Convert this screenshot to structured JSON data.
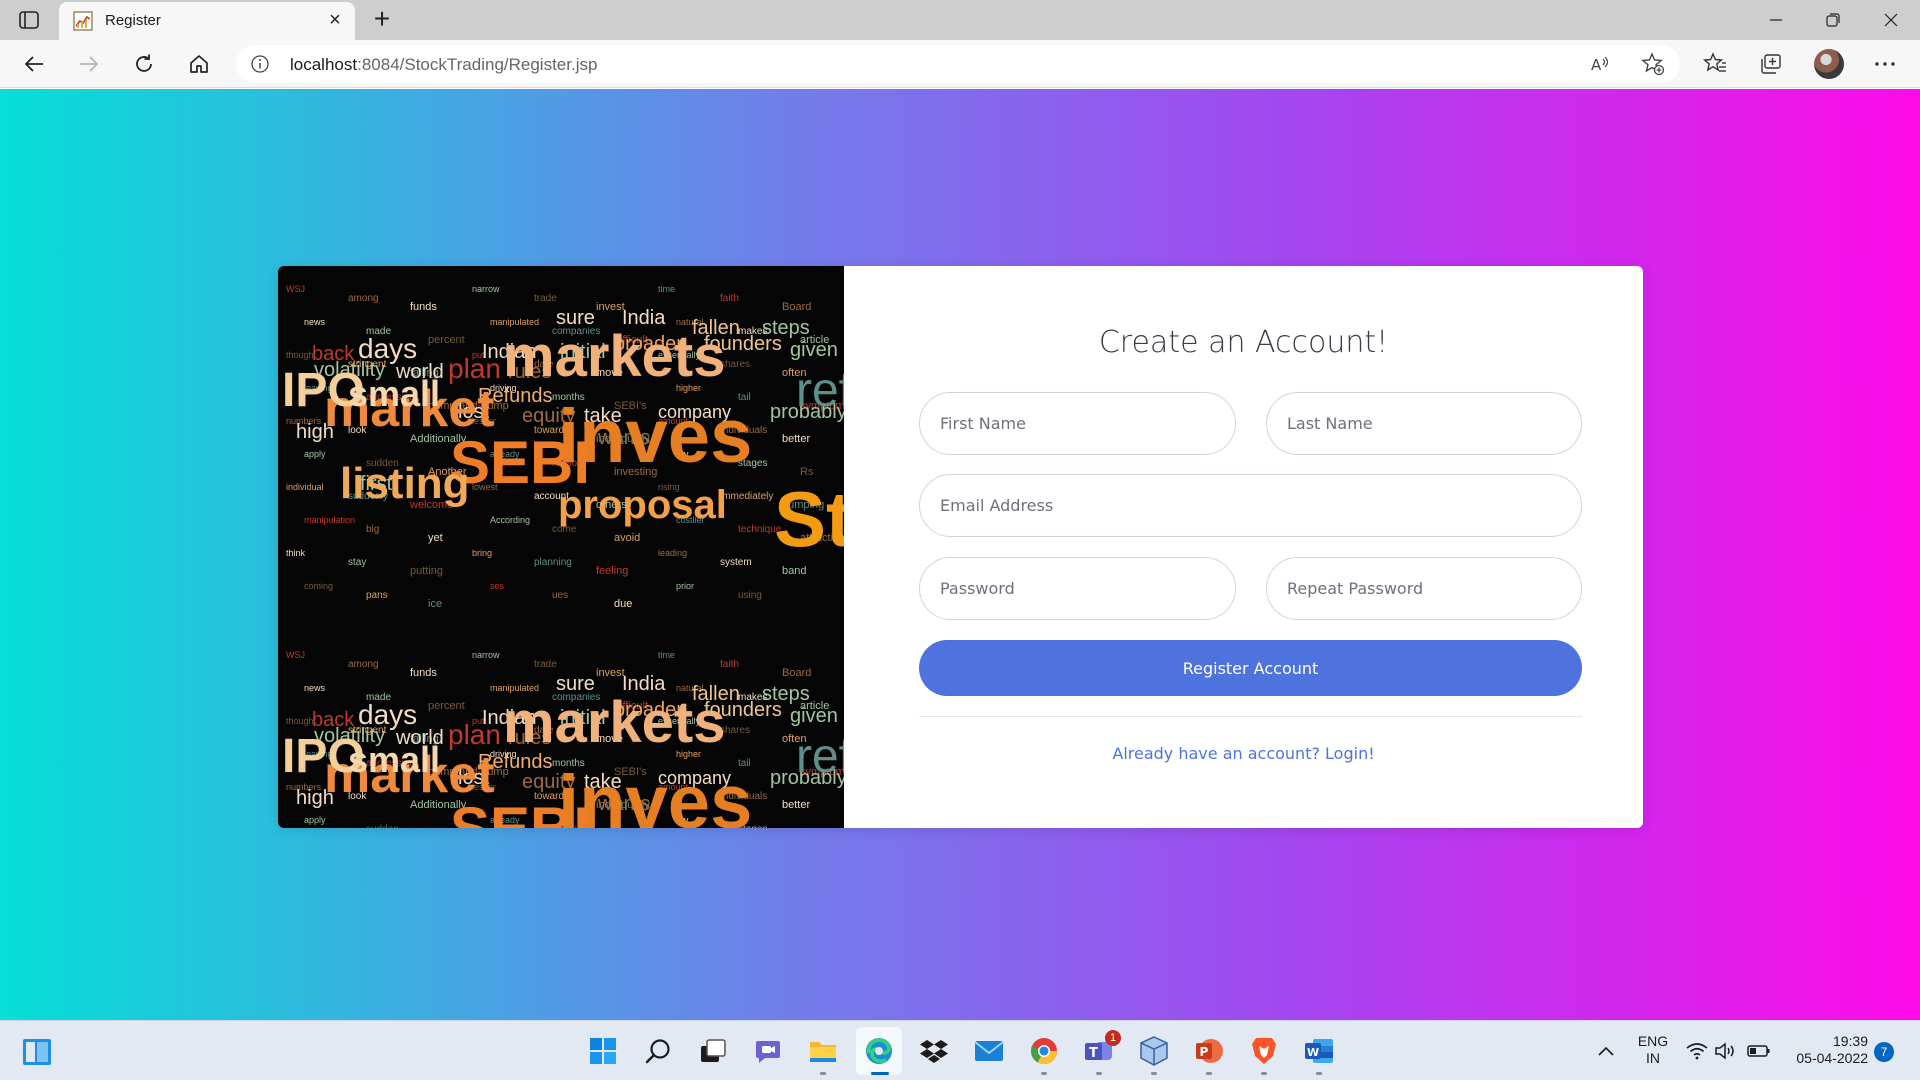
{
  "browser": {
    "tab_title": "Register",
    "new_tab_label": "+",
    "tab_close_label": "×",
    "url_host": "localhost",
    "url_rest": ":8084/StockTrading/Register.jsp"
  },
  "image_words": {
    "huge": [
      "markets",
      "inves",
      "market",
      "SEBI",
      "IPO",
      "listing",
      "proposal",
      "small",
      "St"
    ],
    "medium": [
      "days",
      "Indian",
      "founders",
      "fallen",
      "broader",
      "India",
      "sure",
      "world",
      "plan",
      "volatility",
      "Refunds",
      "equity",
      "take",
      "company",
      "probably",
      "wants",
      "high",
      "back",
      "lost",
      "first",
      "rules",
      "initial",
      "steps",
      "given",
      "refu"
    ],
    "small": [
      "WSJ",
      "among",
      "funds",
      "narrow",
      "trade",
      "invest",
      "time",
      "faith",
      "Board",
      "news",
      "made",
      "percent",
      "manipulated",
      "companies",
      "difficult",
      "natural",
      "makes",
      "article",
      "thought",
      "stringent",
      "falling",
      "put",
      "date",
      "move",
      "essentially",
      "shares",
      "often",
      "leaving",
      "addressing",
      "pump-and-dump",
      "driving",
      "months",
      "SEBI's",
      "higher",
      "tail",
      "symptom",
      "numbers",
      "look",
      "Additionally",
      "lesser",
      "towards",
      "individually",
      "amount",
      "Individuals",
      "better",
      "apply",
      "sudden",
      "Another",
      "already",
      "reason",
      "investing",
      "dry",
      "stages",
      "Rs",
      "individual",
      "suddenly",
      "welcome",
      "lowest",
      "account",
      "others",
      "rising",
      "immediately",
      "dumping",
      "manipulation",
      "big",
      "yet",
      "According",
      "come",
      "avoid",
      "costlier",
      "technique",
      "attracting",
      "think",
      "stay",
      "putting",
      "bring",
      "planning",
      "feeling",
      "leading",
      "system",
      "band",
      "coming",
      "pans",
      "ice",
      "ses",
      "ues",
      "due",
      "prior",
      "using"
    ]
  },
  "form": {
    "title": "Create an Account!",
    "first_name_placeholder": "First Name",
    "last_name_placeholder": "Last Name",
    "email_placeholder": "Email Address",
    "password_placeholder": "Password",
    "repeat_password_placeholder": "Repeat Password",
    "register_label": "Register Account",
    "login_link": "Already have an account? Login!"
  },
  "taskbar": {
    "lang_line1": "ENG",
    "lang_line2": "IN",
    "time": "19:39",
    "date": "05-04-2022",
    "notification_count": "7",
    "teams_badge": "1"
  },
  "colors": {
    "gradient_start": "#05dfd7",
    "gradient_end": "#fe0ae9",
    "primary": "#4e73df"
  }
}
